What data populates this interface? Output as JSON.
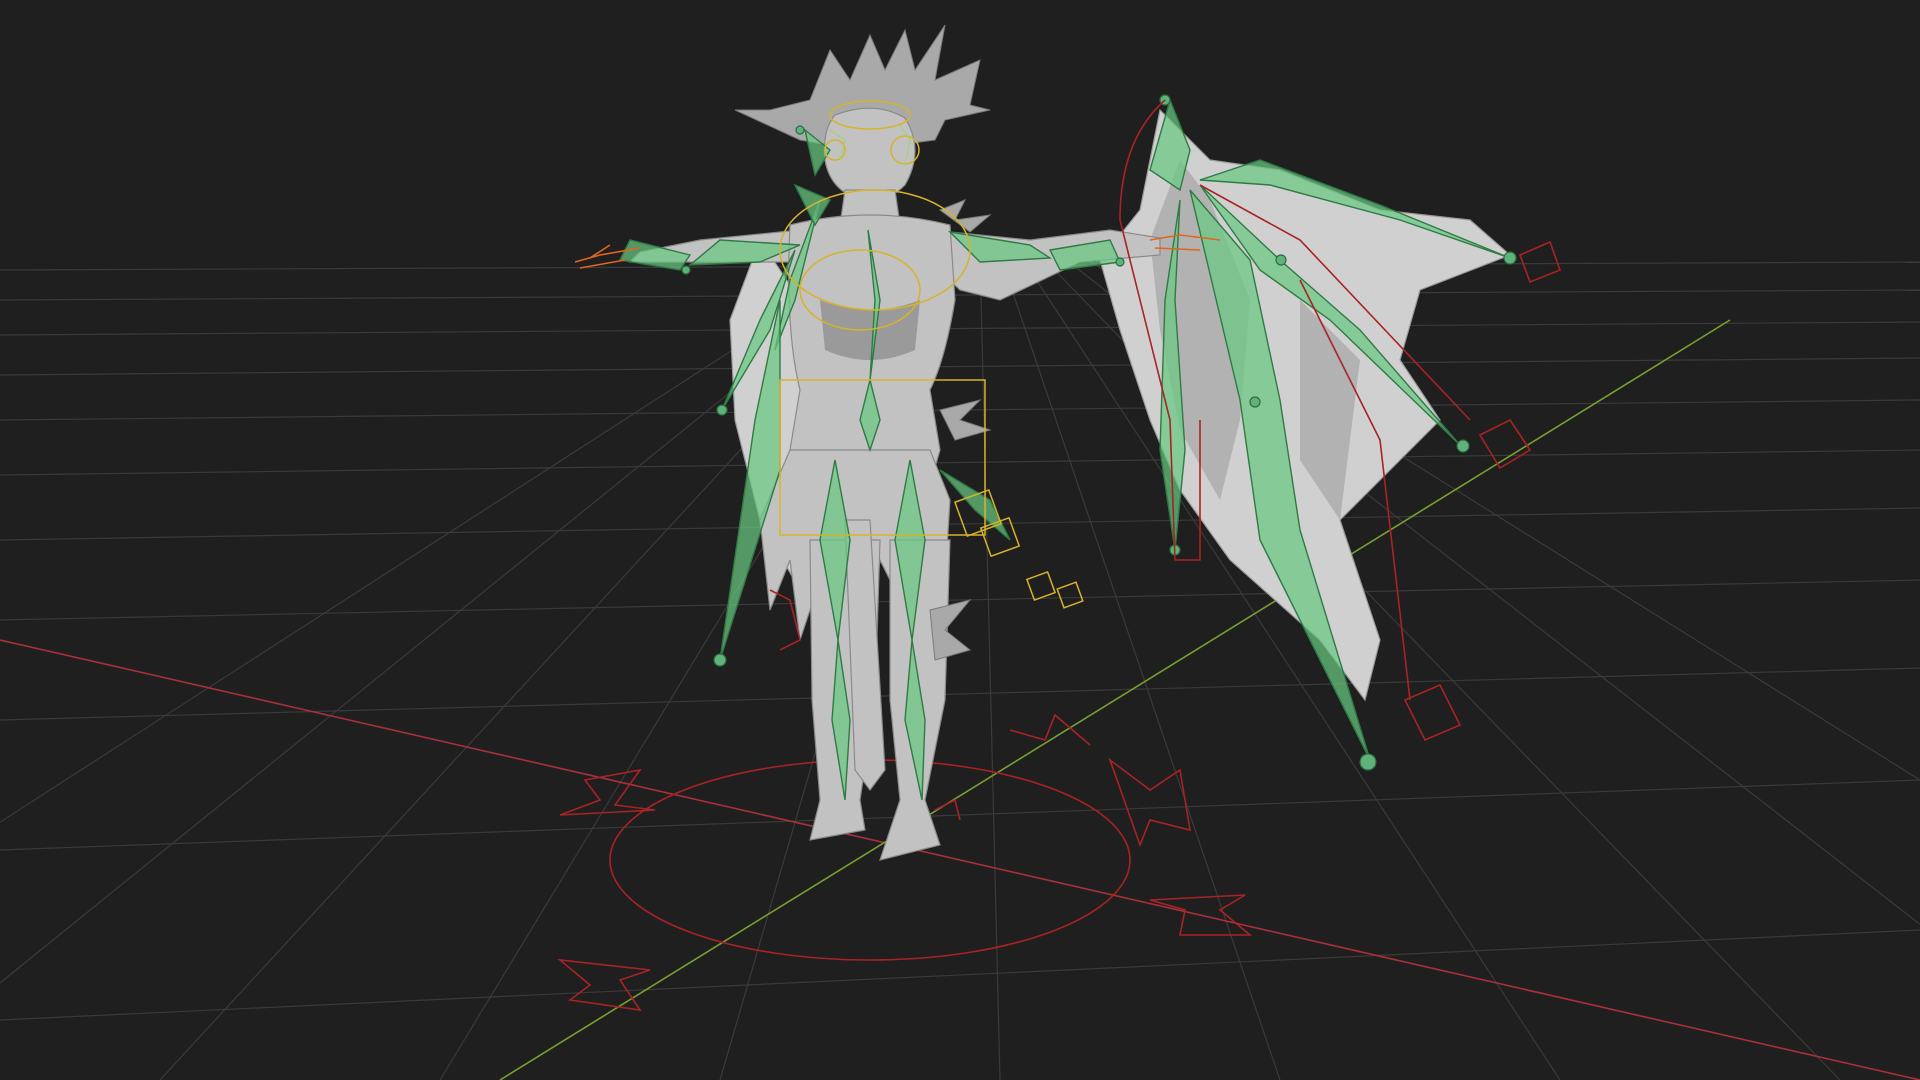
{
  "viewport": {
    "kind": "3d-viewport",
    "shading": "solid",
    "subject": "winged-creature-rig",
    "colors": {
      "background": "#1f1f1f",
      "grid": "#3a3a3a",
      "x_axis": "#a8303a",
      "y_axis": "#78a030",
      "mesh": "#c2c2c2",
      "bone": "#69c882",
      "control_red": "#a82325",
      "control_yellow": "#d6b42a",
      "control_orange": "#e0651e"
    }
  }
}
